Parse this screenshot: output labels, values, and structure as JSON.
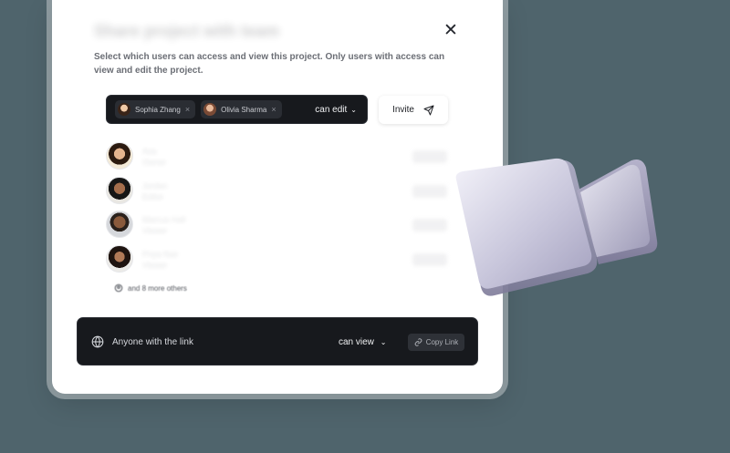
{
  "dialog": {
    "title": "Share project with team",
    "description": "Select which users can access and view this project. Only users with access can view and edit the project.",
    "close_icon": "close-icon"
  },
  "invite": {
    "chips": [
      {
        "name": "Sophia Zhang"
      },
      {
        "name": "Olivia Sharma"
      }
    ],
    "permission": "can edit",
    "button_label": "Invite"
  },
  "users": [
    {
      "name": "Ava",
      "role": "Owner",
      "access": "owner"
    },
    {
      "name": "Jordan",
      "role": "Editor",
      "access": "editor"
    },
    {
      "name": "Marcus Hall",
      "role": "Viewer",
      "access": "viewer"
    },
    {
      "name": "Priya Nair",
      "role": "Viewer",
      "access": "viewer"
    }
  ],
  "more_label": "and 8 more others",
  "link": {
    "label": "Anyone with the link",
    "permission": "can view",
    "copy_label": "Copy Link"
  },
  "colors": {
    "background": "#4f646c",
    "dark_bar": "#17191d",
    "card": "#ffffff"
  }
}
